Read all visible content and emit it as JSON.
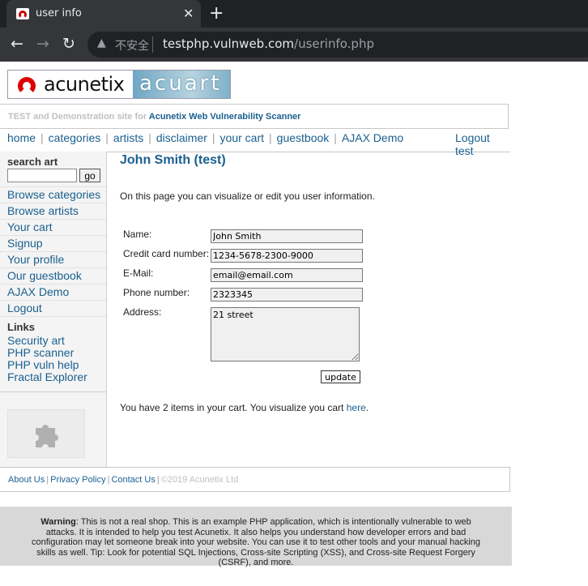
{
  "browser": {
    "tab_title": "user info",
    "tab_close": "✕",
    "new_tab": "+",
    "nav_back": "←",
    "nav_forward": "→",
    "nav_reload": "↻",
    "security_icon": "▲",
    "security_label": "不安全",
    "url_host": "testphp.vulnweb.com",
    "url_path": "/userinfo.php"
  },
  "logo": {
    "left_text": "acunetix",
    "right_text": "acuart"
  },
  "tagline": {
    "prefix": "TEST and Demonstration site for ",
    "link": "Acunetix Web Vulnerability Scanner"
  },
  "topnav": {
    "items": [
      "home",
      "categories",
      "artists",
      "disclaimer",
      "your cart",
      "guestbook",
      "AJAX Demo"
    ],
    "divider": "|",
    "logout": "Logout test"
  },
  "sidebar": {
    "search_label": "search art",
    "search_value": "",
    "go_label": "go",
    "items": [
      "Browse categories",
      "Browse artists",
      "Your cart",
      "Signup",
      "Your profile",
      "Our guestbook",
      "AJAX Demo",
      "Logout"
    ],
    "links_heading": "Links",
    "links": [
      "Security art",
      "PHP scanner",
      "PHP vuln help",
      "Fractal Explorer"
    ]
  },
  "main": {
    "title": "John Smith (test)",
    "intro": "On this page you can visualize or edit you user information.",
    "form": {
      "name_label": "Name:",
      "name_value": "John Smith",
      "cc_label": "Credit card number:",
      "cc_value": "1234-5678-2300-9000",
      "email_label": "E-Mail:",
      "email_value": "email@email.com",
      "phone_label": "Phone number:",
      "phone_value": "2323345",
      "address_label": "Address:",
      "address_value": "21 street",
      "update_label": "update"
    },
    "cart_text": "You have 2 items in your cart. You visualize you cart ",
    "cart_link": "here",
    "cart_suffix": "."
  },
  "footer": {
    "links": [
      "About Us",
      "Privacy Policy",
      "Contact Us"
    ],
    "separator": "|",
    "copyright": "©2019 Acunetix Ltd"
  },
  "warning": {
    "bold": "Warning",
    "text": ": This is not a real shop. This is an example PHP application, which is intentionally vulnerable to web attacks. It is intended to help you test Acunetix. It also helps you understand how developer errors and bad configuration may let someone break into your website. You can use it to test other tools and your manual hacking skills as well. Tip: Look for potential SQL Injections, Cross-site Scripting (XSS), and Cross-site Request Forgery (CSRF), and more."
  },
  "colors": {
    "link": "#1a5f8f",
    "chrome_dark": "#202124",
    "chrome_tab": "#35363a",
    "warning_bg": "#d8d8d8"
  }
}
